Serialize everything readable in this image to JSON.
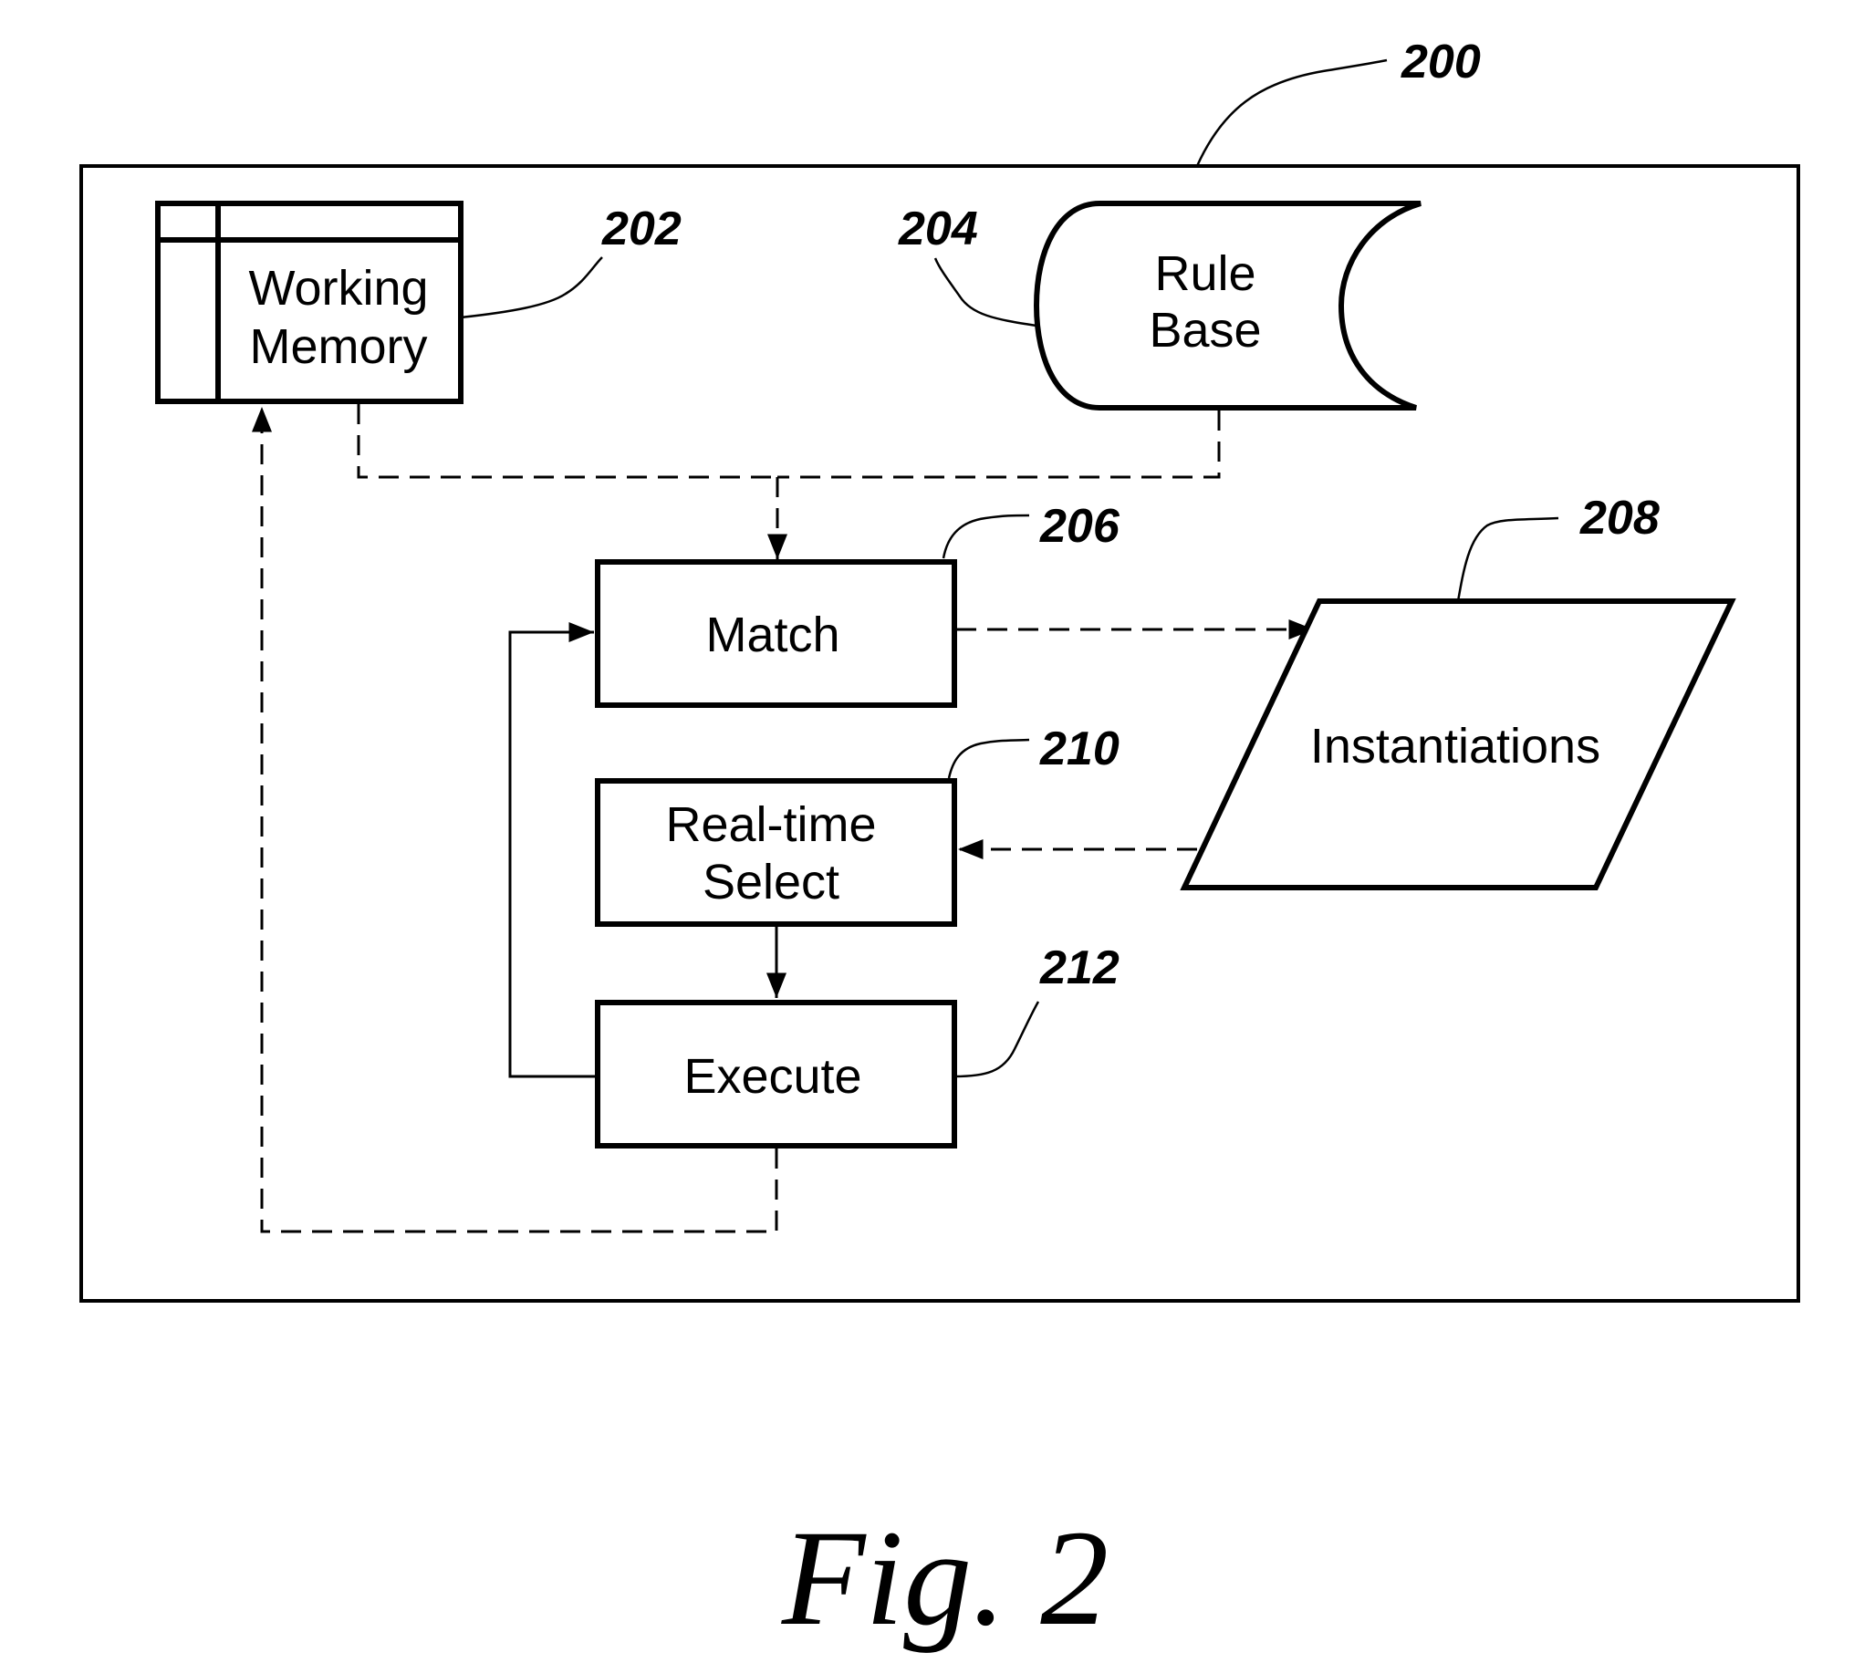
{
  "figure": {
    "caption": "Fig. 2",
    "reference": "200"
  },
  "nodes": {
    "working_memory": {
      "line1": "Working",
      "line2": "Memory",
      "ref": "202"
    },
    "rule_base": {
      "line1": "Rule",
      "line2": "Base",
      "ref": "204"
    },
    "match": {
      "label": "Match",
      "ref": "206"
    },
    "instantiations": {
      "label": "Instantiations",
      "ref": "208"
    },
    "real_time_select": {
      "line1": "Real-time",
      "line2": "Select",
      "ref": "210"
    },
    "execute": {
      "label": "Execute",
      "ref": "212"
    }
  },
  "edges": [
    {
      "from": "working_memory",
      "to": "match",
      "style": "dashed"
    },
    {
      "from": "rule_base",
      "to": "match",
      "style": "dashed"
    },
    {
      "from": "match",
      "to": "instantiations",
      "style": "dashed"
    },
    {
      "from": "instantiations",
      "to": "real_time_select",
      "style": "dashed"
    },
    {
      "from": "real_time_select",
      "to": "execute",
      "style": "solid"
    },
    {
      "from": "execute",
      "to": "match",
      "style": "solid"
    },
    {
      "from": "execute",
      "to": "working_memory",
      "style": "dashed"
    }
  ],
  "colors": {
    "ink": "#000000",
    "paper": "#ffffff"
  }
}
